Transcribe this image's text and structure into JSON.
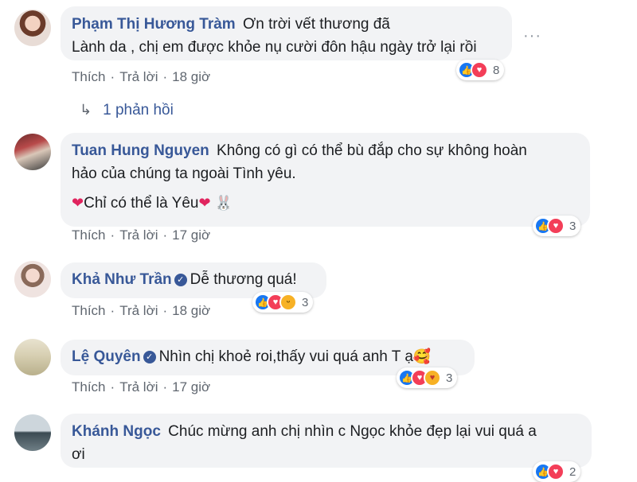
{
  "comments": [
    {
      "author": "Phạm Thị Hương Tràm",
      "line1": "Ơn trời vết thương đã",
      "line2": "Lành da , chị em được khỏe nụ cười đôn hậu ngày trở lại rồi",
      "like": "Thích",
      "reply": "Trả lời",
      "time": "18 giờ",
      "reaction_count": "8",
      "replies": "1 phản hồi"
    },
    {
      "author": "Tuan Hung Nguyen",
      "line1": "Không có gì có thể bù đắp cho sự không hoàn",
      "line2": "hảo của chúng ta ngoài Tình yêu.",
      "line3": "Chỉ có thể là Yêu",
      "like": "Thích",
      "reply": "Trả lời",
      "time": "17 giờ",
      "reaction_count": "3"
    },
    {
      "author": "Khả Như Trần",
      "text": "Dễ thương quá!",
      "like": "Thích",
      "reply": "Trả lời",
      "time": "18 giờ",
      "reaction_count": "3"
    },
    {
      "author": "Lệ Quyên",
      "text": "Nhìn chị khoẻ roi,thấy vui quá anh T ạ",
      "like": "Thích",
      "reply": "Trả lời",
      "time": "17 giờ",
      "reaction_count": "3"
    },
    {
      "author": "Khánh Ngọc",
      "line1": "Chúc mừng anh chị nhìn c Ngọc khỏe đẹp lại vui quá a",
      "line2": "ơi",
      "reaction_count": "2"
    }
  ],
  "icons": {
    "more": "more-options-icon",
    "reply_arrow": "reply-arrow-icon",
    "like": "like-reaction-icon",
    "love": "love-reaction-icon",
    "haha": "haha-reaction-icon",
    "care": "care-reaction-icon"
  },
  "colors": {
    "name": "#385898",
    "bubble": "#f2f3f5",
    "like": "#1877f2",
    "love": "#f33e58"
  }
}
